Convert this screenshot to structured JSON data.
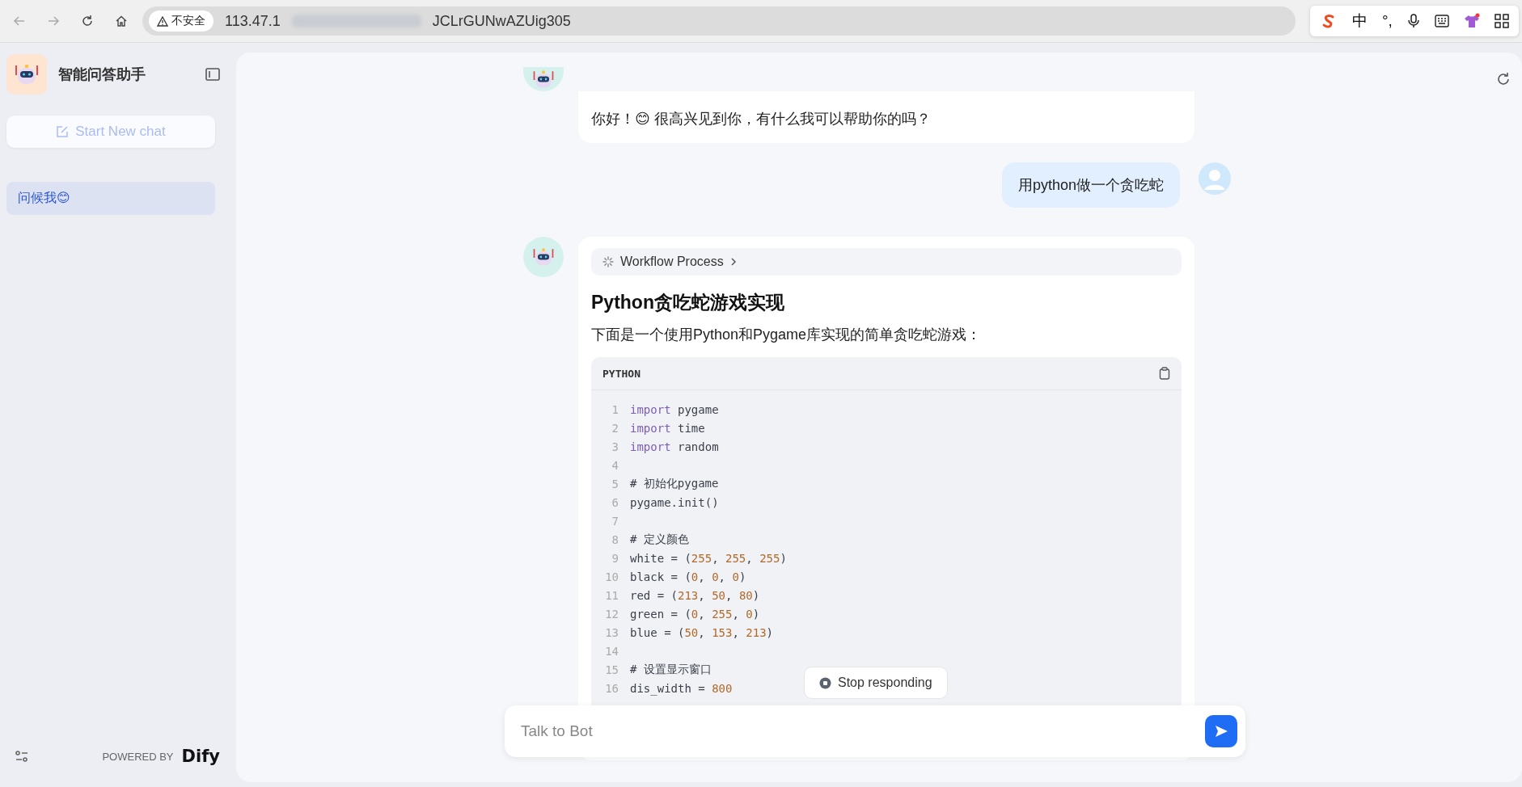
{
  "browser": {
    "security_label": "不安全",
    "url_start": "113.47.1",
    "url_end": "JCLrGUNwAZUig305",
    "ime": [
      "中",
      "°,"
    ]
  },
  "sidebar": {
    "app_title": "智能问答助手",
    "new_chat": "Start New chat",
    "conversations": [
      {
        "title": "问候我😊",
        "selected": true
      }
    ],
    "powered_by": "POWERED BY",
    "brand": "Dify"
  },
  "messages": [
    {
      "kind": "bot",
      "text": "你好！😊 很高兴见到你，有什么我可以帮助你的吗？"
    },
    {
      "kind": "user",
      "text": "用python做一个贪吃蛇"
    },
    {
      "kind": "bot",
      "workflow": "Workflow Process",
      "heading": "Python贪吃蛇游戏实现",
      "text": "下面是一个使用Python和Pygame库实现的简单贪吃蛇游戏：",
      "code": {
        "language": "PYTHON",
        "lines": [
          {
            "number": "1",
            "tokens": [
              {
                "kind": "keyword",
                "text": "import"
              },
              {
                "kind": "plain",
                "text": " pygame"
              }
            ]
          },
          {
            "number": "2",
            "tokens": [
              {
                "kind": "keyword",
                "text": "import"
              },
              {
                "kind": "plain",
                "text": " time"
              }
            ]
          },
          {
            "number": "3",
            "tokens": [
              {
                "kind": "keyword",
                "text": "import"
              },
              {
                "kind": "plain",
                "text": " random"
              }
            ]
          },
          {
            "number": "4"
          },
          {
            "number": "5",
            "tokens": [
              {
                "kind": "plain",
                "text": "# 初始化pygame"
              }
            ]
          },
          {
            "number": "6",
            "tokens": [
              {
                "kind": "plain",
                "text": "pygame.init()"
              }
            ]
          },
          {
            "number": "7"
          },
          {
            "number": "8",
            "tokens": [
              {
                "kind": "plain",
                "text": "# 定义颜色"
              }
            ]
          },
          {
            "number": "9",
            "tokens": [
              {
                "kind": "plain",
                "text": "white = ("
              },
              {
                "kind": "number",
                "text": "255"
              },
              {
                "kind": "plain",
                "text": ", "
              },
              {
                "kind": "number",
                "text": "255"
              },
              {
                "kind": "plain",
                "text": ", "
              },
              {
                "kind": "number",
                "text": "255"
              },
              {
                "kind": "plain",
                "text": ")"
              }
            ]
          },
          {
            "number": "10",
            "tokens": [
              {
                "kind": "plain",
                "text": "black = ("
              },
              {
                "kind": "number",
                "text": "0"
              },
              {
                "kind": "plain",
                "text": ", "
              },
              {
                "kind": "number",
                "text": "0"
              },
              {
                "kind": "plain",
                "text": ", "
              },
              {
                "kind": "number",
                "text": "0"
              },
              {
                "kind": "plain",
                "text": ")"
              }
            ]
          },
          {
            "number": "11",
            "tokens": [
              {
                "kind": "plain",
                "text": "red = ("
              },
              {
                "kind": "number",
                "text": "213"
              },
              {
                "kind": "plain",
                "text": ", "
              },
              {
                "kind": "number",
                "text": "50"
              },
              {
                "kind": "plain",
                "text": ", "
              },
              {
                "kind": "number",
                "text": "80"
              },
              {
                "kind": "plain",
                "text": ")"
              }
            ]
          },
          {
            "number": "12",
            "tokens": [
              {
                "kind": "plain",
                "text": "green = ("
              },
              {
                "kind": "number",
                "text": "0"
              },
              {
                "kind": "plain",
                "text": ", "
              },
              {
                "kind": "number",
                "text": "255"
              },
              {
                "kind": "plain",
                "text": ", "
              },
              {
                "kind": "number",
                "text": "0"
              },
              {
                "kind": "plain",
                "text": ")"
              }
            ]
          },
          {
            "number": "13",
            "tokens": [
              {
                "kind": "plain",
                "text": "blue = ("
              },
              {
                "kind": "number",
                "text": "50"
              },
              {
                "kind": "plain",
                "text": ", "
              },
              {
                "kind": "number",
                "text": "153"
              },
              {
                "kind": "plain",
                "text": ", "
              },
              {
                "kind": "number",
                "text": "213"
              },
              {
                "kind": "plain",
                "text": ")"
              }
            ]
          },
          {
            "number": "14"
          },
          {
            "number": "15",
            "tokens": [
              {
                "kind": "plain",
                "text": "# 设置显示窗口"
              }
            ]
          },
          {
            "number": "16",
            "tokens": [
              {
                "kind": "plain",
                "text": "dis_width = "
              },
              {
                "kind": "number",
                "text": "800"
              }
            ]
          }
        ]
      }
    }
  ],
  "stop_button": "Stop responding",
  "composer": {
    "placeholder": "Talk to Bot"
  }
}
